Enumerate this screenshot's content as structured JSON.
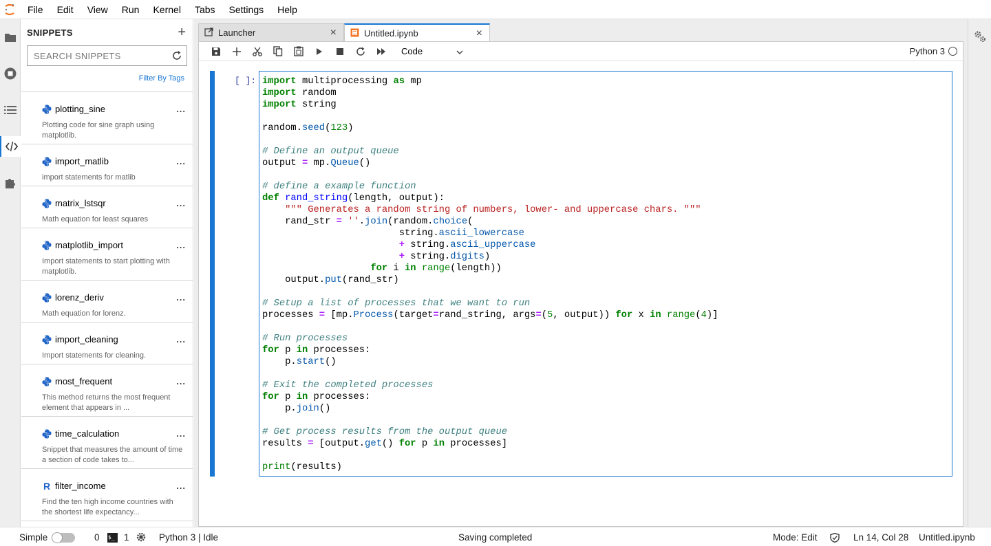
{
  "menubar": {
    "items": [
      "File",
      "Edit",
      "View",
      "Run",
      "Kernel",
      "Tabs",
      "Settings",
      "Help"
    ]
  },
  "sidebar": {
    "title": "SNIPPETS",
    "add_label": "+",
    "search_placeholder": "SEARCH SNIPPETS",
    "filter_label": "Filter By Tags",
    "snippets": [
      {
        "name": "plotting_sine",
        "lang": "python",
        "description": "Plotting code for sine graph using matplotlib."
      },
      {
        "name": "import_matlib",
        "lang": "python",
        "description": "import statements for matlib"
      },
      {
        "name": "matrix_lstsqr",
        "lang": "python",
        "description": "Math equation for least squares"
      },
      {
        "name": "matplotlib_import",
        "lang": "python",
        "description": "Import statements to start plotting with matplotlib."
      },
      {
        "name": "lorenz_deriv",
        "lang": "python",
        "description": "Math equation for lorenz."
      },
      {
        "name": "import_cleaning",
        "lang": "python",
        "description": "Import statements for cleaning."
      },
      {
        "name": "most_frequent",
        "lang": "python",
        "description": "This method returns the most frequent element that appears in ..."
      },
      {
        "name": "time_calculation",
        "lang": "python",
        "description": "Snippet that measures the amount of time a section of code takes to..."
      },
      {
        "name": "filter_income",
        "lang": "R",
        "description": "Find the ten high income countries with the shortest life expectancy..."
      }
    ],
    "more_label": "...",
    "r_label": "R"
  },
  "tabs": [
    {
      "label": "Launcher",
      "active": false
    },
    {
      "label": "Untitled.ipynb",
      "active": true
    }
  ],
  "tab_close": "×",
  "toolbar": {
    "cell_type": "Code",
    "kernel": "Python 3"
  },
  "cell": {
    "prompt": "[ ]:",
    "source": "import multiprocessing as mp\nimport random\nimport string\n\nrandom.seed(123)\n\n# Define an output queue\noutput = mp.Queue()\n\n# define a example function\ndef rand_string(length, output):\n    \"\"\" Generates a random string of numbers, lower- and uppercase chars. \"\"\"\n    rand_str = ''.join(random.choice(\n                        string.ascii_lowercase\n                        + string.ascii_uppercase\n                        + string.digits)\n                   for i in range(length))\n    output.put(rand_str)\n\n# Setup a list of processes that we want to run\nprocesses = [mp.Process(target=rand_string, args=(5, output)) for x in range(4)]\n\n# Run processes\nfor p in processes:\n    p.start()\n\n# Exit the completed processes\nfor p in processes:\n    p.join()\n\n# Get process results from the output queue\nresults = [output.get() for p in processes]\n\nprint(results)"
  },
  "statusbar": {
    "mode_label": "Simple",
    "terminals_count": "0",
    "terminal_glyph": "$_",
    "kernels_count": "1",
    "kernel_status": "Python 3 | Idle",
    "message": "Saving completed",
    "mode": "Mode: Edit",
    "cursor": "Ln 14, Col 28",
    "filename": "Untitled.ipynb"
  },
  "colors": {
    "accent": "#1976d2",
    "keyword": "#008000",
    "comment": "#408080",
    "string": "#ba2121",
    "function": "#0000ff"
  }
}
